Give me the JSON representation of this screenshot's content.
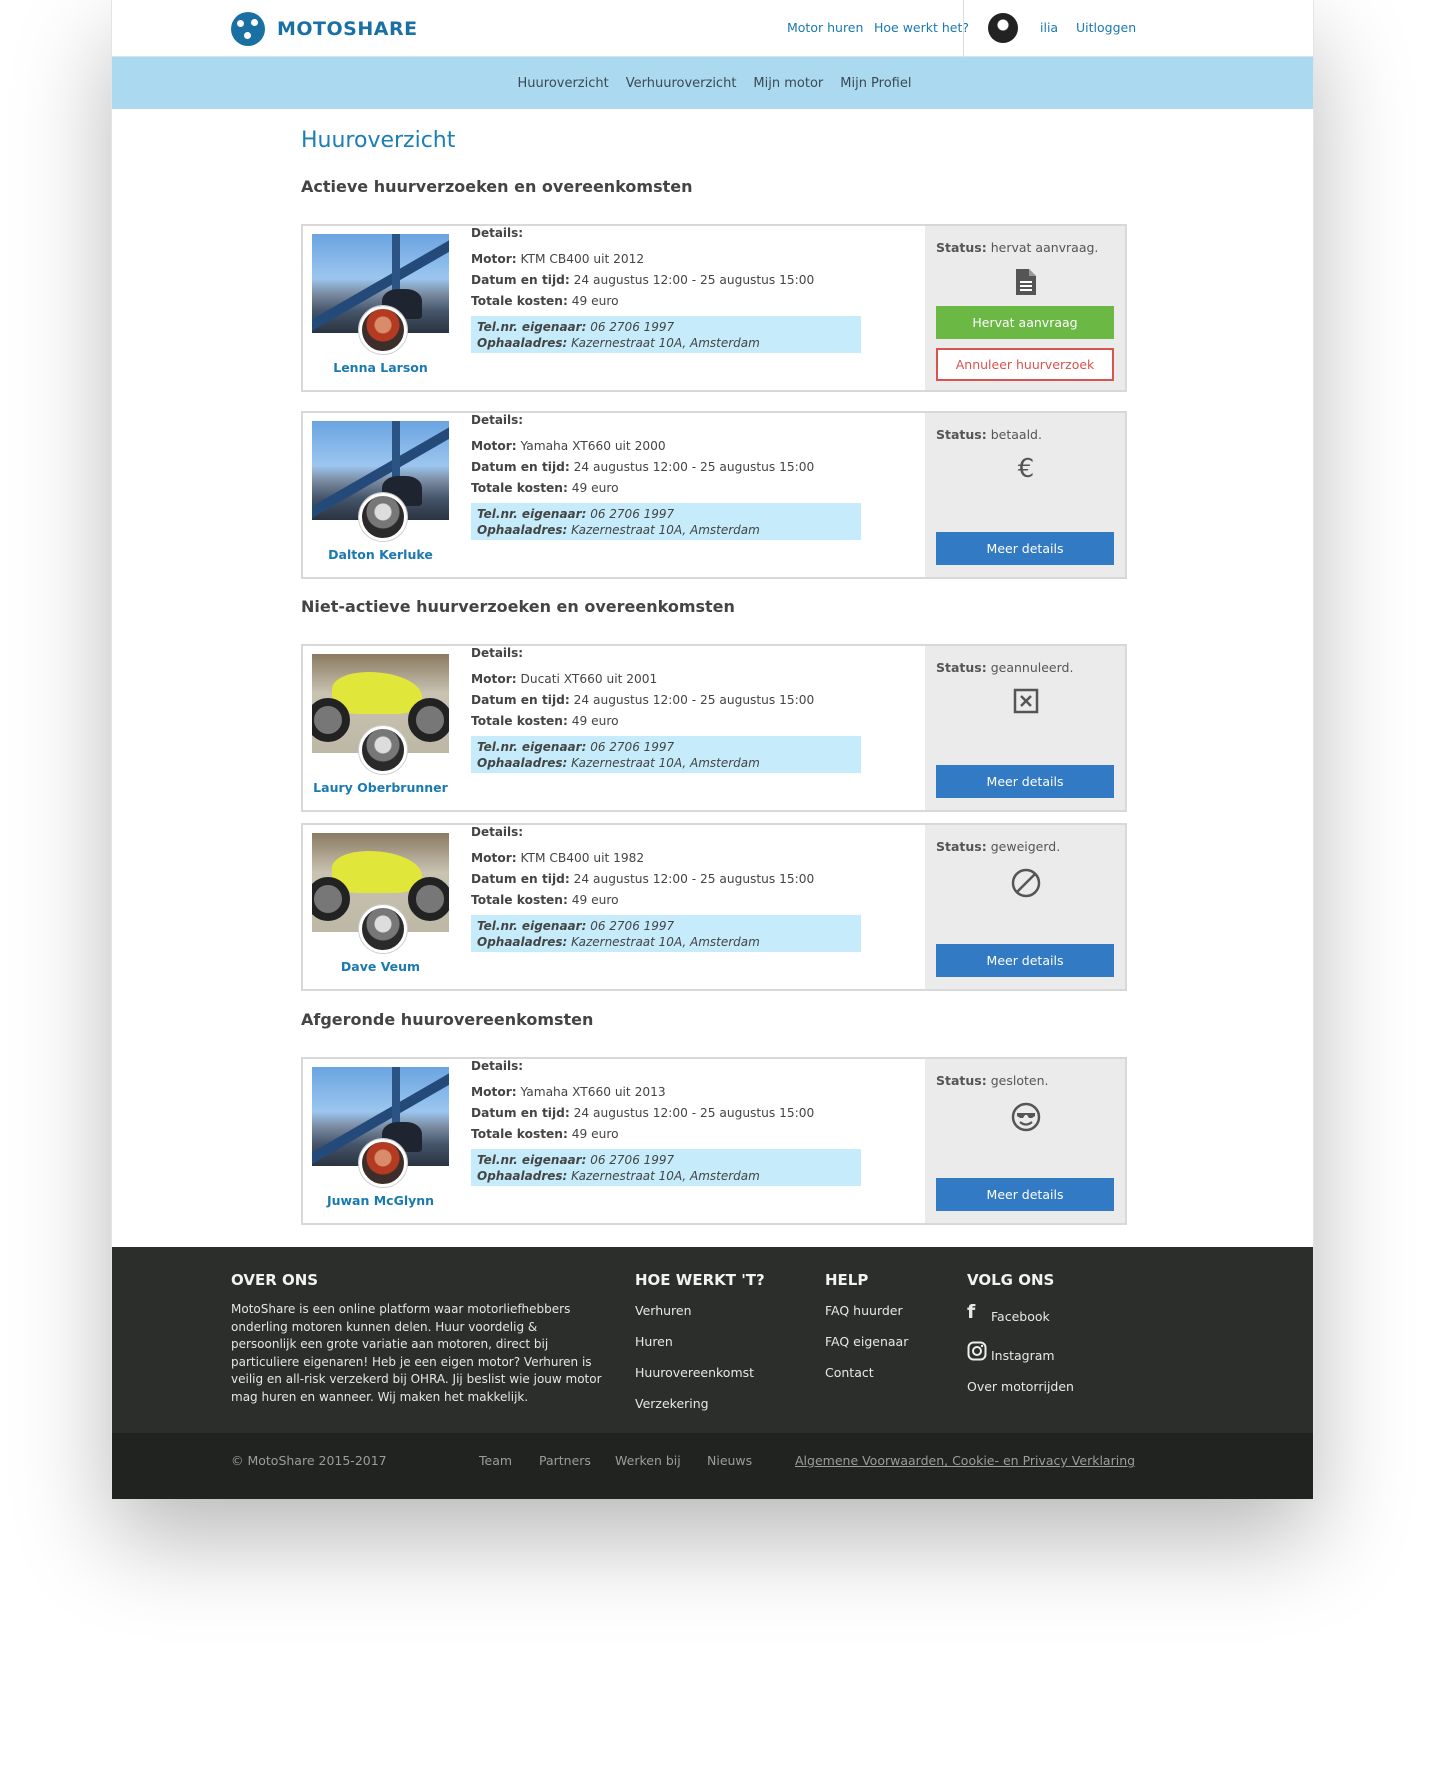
{
  "header": {
    "brand": "MOTOSHARE",
    "nav": [
      "Motor huren",
      "Hoe werkt het?"
    ],
    "user_name": "ilia",
    "logout": "Uitloggen"
  },
  "subnav": [
    "Huuroverzicht",
    "Verhuuroverzicht",
    "Mijn motor",
    "Mijn Profiel"
  ],
  "page_title": "Huuroverzicht",
  "labels": {
    "details": "Details:",
    "motor": "Motor:",
    "datum": "Datum en tijd:",
    "kosten": "Totale kosten:",
    "tel": "Tel.nr. eigenaar:",
    "adres": "Ophaaladres:",
    "status": "Status:"
  },
  "sections": [
    {
      "title": "Actieve huurverzoeken en overeenkomsten",
      "cards": [
        {
          "owner": "Lenna Larson",
          "motor": "KTM CB400 uit 2012",
          "datum": "24 augustus 12:00 - 25 augustus 15:00",
          "kosten": "49 euro",
          "tel": "06 2706 1997",
          "adres": "Kazernestraat 10A, Amsterdam",
          "status": "hervat aanvraag.",
          "icon": "document-icon",
          "btn_primary": "Hervat aanvraag",
          "btn_secondary": "Annuleer huurverzoek"
        },
        {
          "owner": "Dalton Kerluke",
          "motor": "Yamaha XT660 uit 2000",
          "datum": "24 augustus 12:00 - 25 augustus 15:00",
          "kosten": "49 euro",
          "tel": "06 2706 1997",
          "adres": "Kazernestraat 10A, Amsterdam",
          "status": "betaald.",
          "icon": "euro-icon",
          "btn_primary": "Meer details"
        }
      ]
    },
    {
      "title": "Niet-actieve huurverzoeken en overeenkomsten",
      "cards": [
        {
          "owner": "Laury Oberbrunner",
          "motor": "Ducati XT660 uit 2001",
          "datum": "24 augustus 12:00 - 25 augustus 15:00",
          "kosten": "49 euro",
          "tel": "06 2706 1997",
          "adres": "Kazernestraat 10A, Amsterdam",
          "status": "geannuleerd.",
          "icon": "cancel-box-icon",
          "btn_primary": "Meer details"
        },
        {
          "owner": "Dave Veum",
          "motor": "KTM CB400 uit 1982",
          "datum": "24 augustus 12:00 - 25 augustus 15:00",
          "kosten": "49 euro",
          "tel": "06 2706 1997",
          "adres": "Kazernestraat 10A, Amsterdam",
          "status": "geweigerd.",
          "icon": "forbidden-icon",
          "btn_primary": "Meer details"
        }
      ]
    },
    {
      "title": "Afgeronde huurovereenkomsten",
      "cards": [
        {
          "owner": "Juwan McGlynn",
          "motor": "Yamaha XT660 uit 2013",
          "datum": "24 augustus 12:00 - 25 augustus 15:00",
          "kosten": "49 euro",
          "tel": "06 2706 1997",
          "adres": "Kazernestraat 10A, Amsterdam",
          "status": "gesloten.",
          "icon": "cool-smiley-icon",
          "btn_primary": "Meer details"
        }
      ]
    }
  ],
  "footer": {
    "about_title": "OVER ONS",
    "about_text": "MotoShare is een online platform waar motorliefhebbers onderling motoren kunnen delen. Huur voordelig & persoonlijk een grote variatie aan motoren, direct bij particuliere eigenaren! Heb je een eigen motor? Verhuren is veilig en all-risk verzekerd bij OHRA. Jij beslist wie jouw motor mag huren en wanneer. Wij maken het makkelijk.",
    "how_title": "HOE WERKT 'T?",
    "how_links": [
      "Verhuren",
      "Huren",
      "Huurovereenkomst",
      "Verzekering"
    ],
    "help_title": "HELP",
    "help_links": [
      "FAQ huurder",
      "FAQ eigenaar",
      "Contact"
    ],
    "follow_title": "VOLG ONS",
    "follow_links": [
      "Facebook",
      "Instagram",
      "Over motorrijden"
    ],
    "copyright": "© MotoShare 2015-2017",
    "bottom_links": [
      "Team",
      "Partners",
      "Werken bij",
      "Nieuws"
    ],
    "legal": "Algemene Voorwaarden, Cookie- en Privacy Verklaring"
  }
}
